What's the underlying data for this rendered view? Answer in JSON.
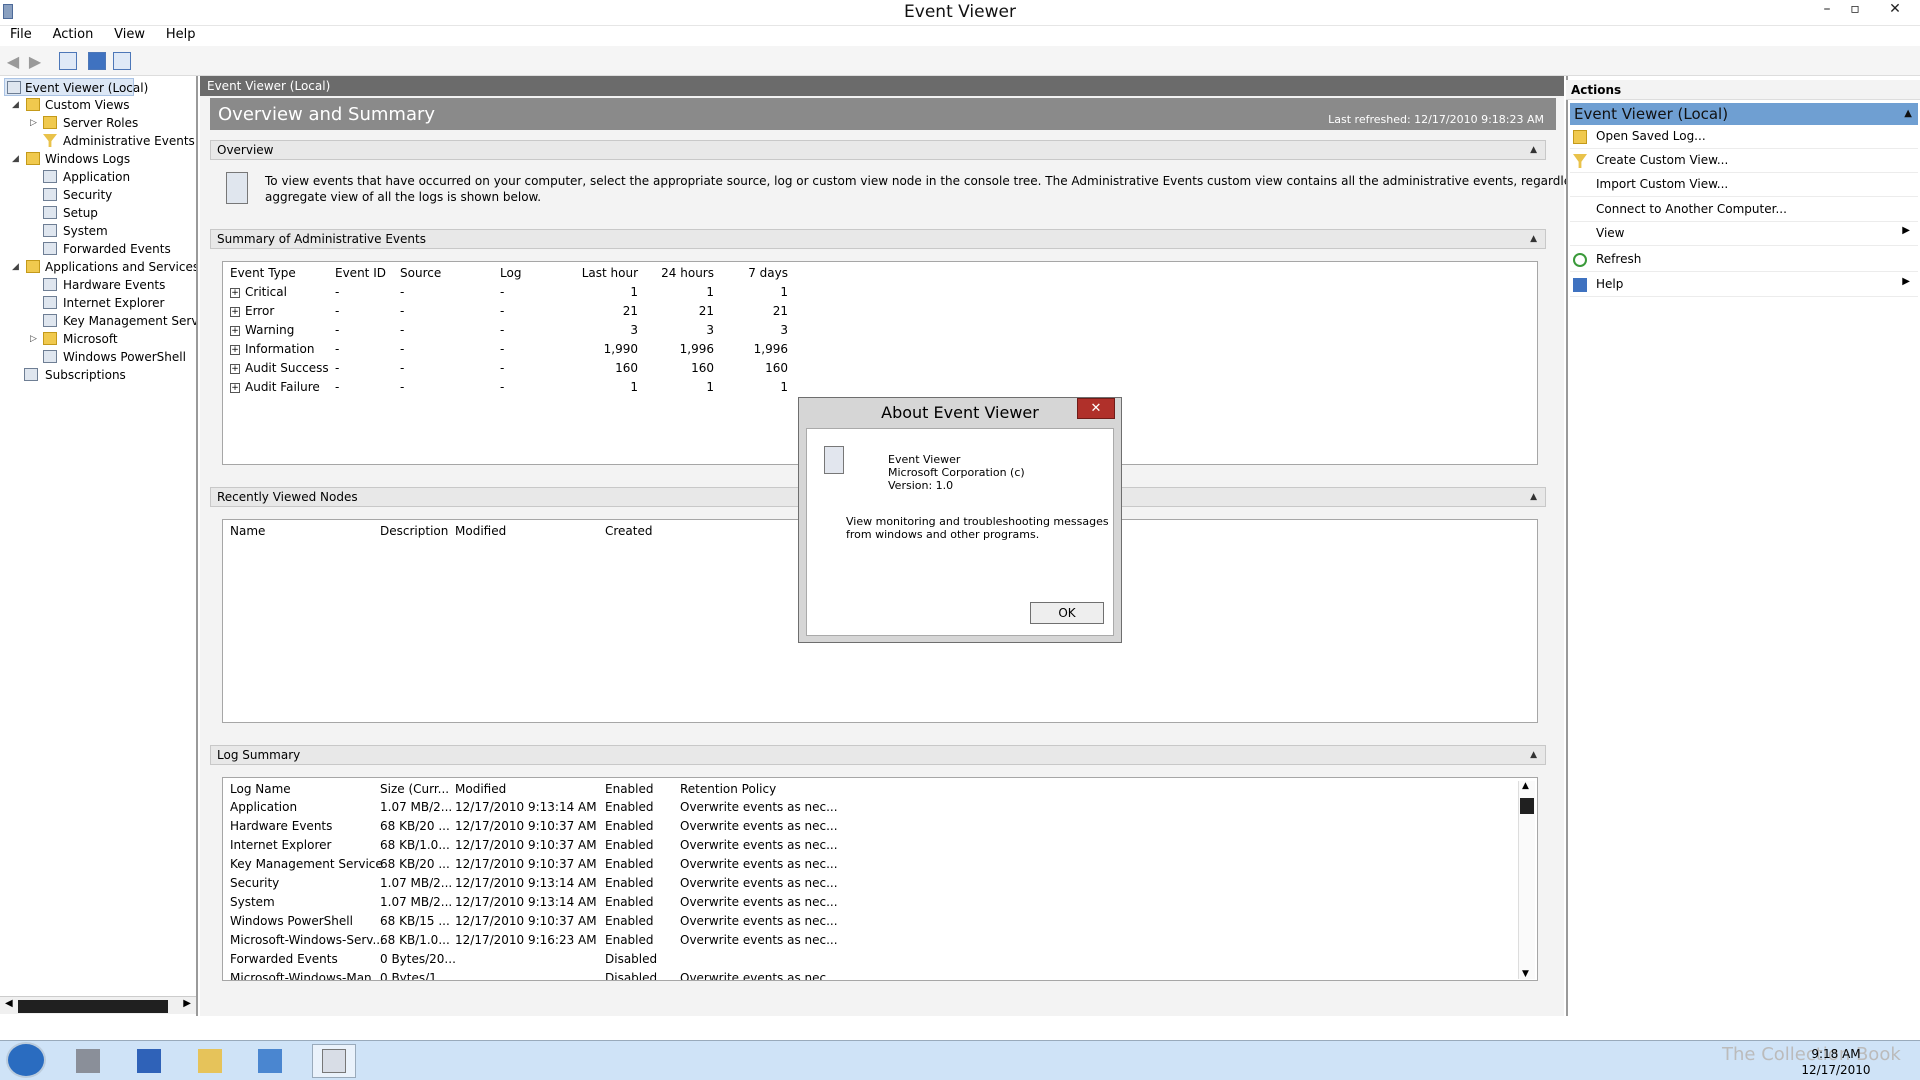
{
  "window": {
    "title": "Event Viewer",
    "min": "–",
    "max": "▫",
    "close": "✕"
  },
  "menu": [
    "File",
    "Action",
    "View",
    "Help"
  ],
  "tree": {
    "root": "Event Viewer (Local)",
    "custom_views": "Custom Views",
    "server_roles": "Server Roles",
    "admin_events": "Administrative Events",
    "windows_logs": "Windows Logs",
    "application": "Application",
    "security": "Security",
    "setup": "Setup",
    "system": "System",
    "forwarded": "Forwarded Events",
    "apps_services": "Applications and Services Lo",
    "hardware": "Hardware Events",
    "ie": "Internet Explorer",
    "kms": "Key Management Service",
    "microsoft": "Microsoft",
    "powershell": "Windows PowerShell",
    "subscriptions": "Subscriptions"
  },
  "center": {
    "header": "Event Viewer (Local)",
    "band_title": "Overview and Summary",
    "last_refreshed": "Last refreshed: 12/17/2010 9:18:23 AM",
    "overview_label": "Overview",
    "overview_text_1": "To view events that have occurred on your computer, select the appropriate source, log or custom view node in the console tree. The Administrative Events custom view contains all the administrative events, regardless of source. An",
    "overview_text_2": "aggregate view of all the logs is shown below.",
    "summary_label": "Summary of Administrative Events",
    "summary_cols": [
      "Event Type",
      "Event ID",
      "Source",
      "Log",
      "Last hour",
      "24 hours",
      "7 days"
    ],
    "summary_rows": [
      {
        "type": "Critical",
        "id": "-",
        "source": "-",
        "log": "-",
        "hour": "1",
        "day": "1",
        "week": "1"
      },
      {
        "type": "Error",
        "id": "-",
        "source": "-",
        "log": "-",
        "hour": "21",
        "day": "21",
        "week": "21"
      },
      {
        "type": "Warning",
        "id": "-",
        "source": "-",
        "log": "-",
        "hour": "3",
        "day": "3",
        "week": "3"
      },
      {
        "type": "Information",
        "id": "-",
        "source": "-",
        "log": "-",
        "hour": "1,990",
        "day": "1,996",
        "week": "1,996"
      },
      {
        "type": "Audit Success",
        "id": "-",
        "source": "-",
        "log": "-",
        "hour": "160",
        "day": "160",
        "week": "160"
      },
      {
        "type": "Audit Failure",
        "id": "-",
        "source": "-",
        "log": "-",
        "hour": "1",
        "day": "1",
        "week": "1"
      }
    ],
    "recent_label": "Recently Viewed Nodes",
    "recent_cols": [
      "Name",
      "Description",
      "Modified",
      "Created"
    ],
    "logsum_label": "Log Summary",
    "logsum_cols": [
      "Log Name",
      "Size (Curr...",
      "Modified",
      "Enabled",
      "Retention Policy"
    ],
    "logsum_rows": [
      {
        "name": "Application",
        "size": "1.07 MB/2...",
        "mod": "12/17/2010 9:13:14 AM",
        "en": "Enabled",
        "ret": "Overwrite events as nec..."
      },
      {
        "name": "Hardware Events",
        "size": "68 KB/20 ...",
        "mod": "12/17/2010 9:10:37 AM",
        "en": "Enabled",
        "ret": "Overwrite events as nec..."
      },
      {
        "name": "Internet Explorer",
        "size": "68 KB/1.0...",
        "mod": "12/17/2010 9:10:37 AM",
        "en": "Enabled",
        "ret": "Overwrite events as nec..."
      },
      {
        "name": "Key Management Service",
        "size": "68 KB/20 ...",
        "mod": "12/17/2010 9:10:37 AM",
        "en": "Enabled",
        "ret": "Overwrite events as nec..."
      },
      {
        "name": "Security",
        "size": "1.07 MB/2...",
        "mod": "12/17/2010 9:13:14 AM",
        "en": "Enabled",
        "ret": "Overwrite events as nec..."
      },
      {
        "name": "System",
        "size": "1.07 MB/2...",
        "mod": "12/17/2010 9:13:14 AM",
        "en": "Enabled",
        "ret": "Overwrite events as nec..."
      },
      {
        "name": "Windows PowerShell",
        "size": "68 KB/15 ...",
        "mod": "12/17/2010 9:10:37 AM",
        "en": "Enabled",
        "ret": "Overwrite events as nec..."
      },
      {
        "name": "Microsoft-Windows-Serv...",
        "size": "68 KB/1.0...",
        "mod": "12/17/2010 9:16:23 AM",
        "en": "Enabled",
        "ret": "Overwrite events as nec..."
      },
      {
        "name": "Forwarded Events",
        "size": "0 Bytes/20...",
        "mod": "",
        "en": "Disabled",
        "ret": ""
      },
      {
        "name": "Microsoft-Windows-Man...",
        "size": "0 Bytes/1...",
        "mod": "",
        "en": "Disabled",
        "ret": "Overwrite events as nec..."
      }
    ]
  },
  "actions": {
    "header": "Actions",
    "section": "Event Viewer (Local)",
    "items": [
      {
        "label": "Open Saved Log...",
        "icon": "folder-open-icon"
      },
      {
        "label": "Create Custom View...",
        "icon": "filter-icon"
      },
      {
        "label": "Import Custom View...",
        "icon": ""
      },
      {
        "label": "Connect to Another Computer...",
        "icon": ""
      },
      {
        "label": "View",
        "icon": "",
        "submenu": true
      },
      {
        "label": "Refresh",
        "icon": "refresh-icon"
      },
      {
        "label": "Help",
        "icon": "help-icon",
        "submenu": true
      }
    ]
  },
  "dialog": {
    "title": "About Event Viewer",
    "close": "✕",
    "name": "Event Viewer",
    "company": "Microsoft Corporation (c)",
    "version": "Version: 1.0",
    "desc_1": "View monitoring and troubleshooting messages",
    "desc_2": "from windows and other programs.",
    "ok": "OK"
  },
  "taskbar": {
    "time": "9:18 AM",
    "date": "12/17/2010",
    "watermark": "The Collection Book"
  },
  "colors": {
    "accent": "#6f9fd2",
    "header_dark": "#6b6b6b",
    "close_red": "#b0302a"
  }
}
